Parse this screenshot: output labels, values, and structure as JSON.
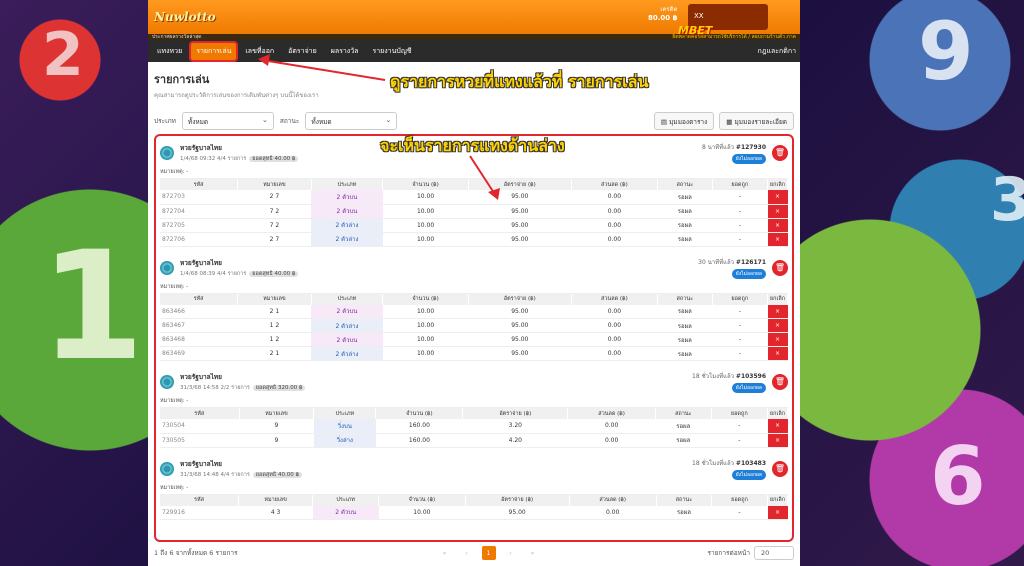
{
  "background": {
    "balls": [
      "2",
      "1",
      "9",
      "3",
      "6"
    ]
  },
  "topbar": {
    "logo": "Nuwlotto",
    "credit_label": "เครดิต",
    "credit_value": "80.00 ฿",
    "user": "XX",
    "brand": "MBET"
  },
  "strip": {
    "left": "ประกาศผลรางวัลล่าสุด",
    "right": "ผิดพลาดคอรัสสามารถใช้บริการได้ / สอบถามร้านตั๋ว ภาค"
  },
  "nav": {
    "items": [
      "แทงหวย",
      "รายการเล่น",
      "เลขที่ออก",
      "อัตราจ่าย",
      "ผลรางวัล",
      "รายงานบัญชี"
    ],
    "right": "กฎและกติกา"
  },
  "page": {
    "title": "รายการเล่น",
    "subtitle": "คุณสามารถดูประวัติการเล่นของการเดิมพันต่างๆ บนนี้ได้ของเรา"
  },
  "filters": {
    "type_label": "ประเภท",
    "type_value": "ทั้งหมด",
    "status_label": "สถานะ",
    "status_value": "ทั้งหมด"
  },
  "view_buttons": [
    "มุมมองตาราง",
    "มุมมองรายละเอียด"
  ],
  "annotations": {
    "top": "ดูรายการหวยที่แทงแล้วที่ รายการเล่น",
    "middle": "จะเห็นรายการแทงด้านล่าง"
  },
  "table_headers": [
    "รหัส",
    "หมายเลข",
    "ประเภท",
    "จำนวน (฿)",
    "อัตราจ่าย (฿)",
    "ส่วนลด (฿)",
    "สถานะ",
    "ยอดถูก",
    "ยกเลิก"
  ],
  "cards": [
    {
      "name": "หวยรัฐบาลไทย",
      "meta": "1/4/68 09:32 4/4 รายการ",
      "total": "ยอดสุทธิ 40.00 ฿",
      "ago": "8 นาทีที่แล้ว",
      "ticket": "#127930",
      "status": "ยังไม่ออกผล",
      "note": "หมายเหตุ: -",
      "rows": [
        {
          "code": "872703",
          "num": "2 7",
          "type": "2 ตัวบน",
          "kind": "top",
          "amount": "10.00",
          "rate": "95.00",
          "discount": "0.00",
          "status": "รอผล",
          "win": "-"
        },
        {
          "code": "872704",
          "num": "7 2",
          "type": "2 ตัวบน",
          "kind": "top",
          "amount": "10.00",
          "rate": "95.00",
          "discount": "0.00",
          "status": "รอผล",
          "win": "-"
        },
        {
          "code": "872705",
          "num": "7 2",
          "type": "2 ตัวล่าง",
          "kind": "bot",
          "amount": "10.00",
          "rate": "95.00",
          "discount": "0.00",
          "status": "รอผล",
          "win": "-"
        },
        {
          "code": "872706",
          "num": "2 7",
          "type": "2 ตัวล่าง",
          "kind": "bot",
          "amount": "10.00",
          "rate": "95.00",
          "discount": "0.00",
          "status": "รอผล",
          "win": "-"
        }
      ]
    },
    {
      "name": "หวยรัฐบาลไทย",
      "meta": "1/4/68 08:39 4/4 รายการ",
      "total": "ยอดสุทธิ 40.00 ฿",
      "ago": "30 นาทีที่แล้ว",
      "ticket": "#126171",
      "status": "ยังไม่ออกผล",
      "note": "หมายเหตุ: -",
      "rows": [
        {
          "code": "863466",
          "num": "2 1",
          "type": "2 ตัวบน",
          "kind": "top",
          "amount": "10.00",
          "rate": "95.00",
          "discount": "0.00",
          "status": "รอผล",
          "win": "-"
        },
        {
          "code": "863467",
          "num": "1 2",
          "type": "2 ตัวล่าง",
          "kind": "bot",
          "amount": "10.00",
          "rate": "95.00",
          "discount": "0.00",
          "status": "รอผล",
          "win": "-"
        },
        {
          "code": "863468",
          "num": "1 2",
          "type": "2 ตัวบน",
          "kind": "top",
          "amount": "10.00",
          "rate": "95.00",
          "discount": "0.00",
          "status": "รอผล",
          "win": "-"
        },
        {
          "code": "863469",
          "num": "2 1",
          "type": "2 ตัวล่าง",
          "kind": "bot",
          "amount": "10.00",
          "rate": "95.00",
          "discount": "0.00",
          "status": "รอผล",
          "win": "-"
        }
      ]
    },
    {
      "name": "หวยรัฐบาลไทย",
      "meta": "31/3/68 14:58 2/2 รายการ",
      "total": "ยอดสุทธิ 320.00 ฿",
      "ago": "18 ชั่วโมงที่แล้ว",
      "ticket": "#103596",
      "status": "ยังไม่ออกผล",
      "note": "หมายเหตุ: -",
      "rows": [
        {
          "code": "730504",
          "num": "9",
          "type": "วิ่งบน",
          "kind": "bot",
          "amount": "160.00",
          "rate": "3.20",
          "discount": "0.00",
          "status": "รอผล",
          "win": "-"
        },
        {
          "code": "730505",
          "num": "9",
          "type": "วิ่งล่าง",
          "kind": "bot",
          "amount": "160.00",
          "rate": "4.20",
          "discount": "0.00",
          "status": "รอผล",
          "win": "-"
        }
      ]
    },
    {
      "name": "หวยรัฐบาลไทย",
      "meta": "31/3/68 14:48 4/4 รายการ",
      "total": "ยอดสุทธิ 40.00 ฿",
      "ago": "18 ชั่วโมงที่แล้ว",
      "ticket": "#103483",
      "status": "ยังไม่ออกผล",
      "note": "หมายเหตุ: -",
      "rows": [
        {
          "code": "729916",
          "num": "4 3",
          "type": "2 ตัวบน",
          "kind": "top",
          "amount": "10.00",
          "rate": "95.00",
          "discount": "0.00",
          "status": "รอผล",
          "win": "-"
        }
      ]
    }
  ],
  "footer": {
    "summary": "1 ถึง 6 จากทั้งหมด 6 รายการ",
    "pages": [
      "«",
      "‹",
      "1",
      "›",
      "»"
    ],
    "active_page": "1",
    "per_page_label": "รายการต่อหน้า",
    "per_page_value": "20"
  }
}
